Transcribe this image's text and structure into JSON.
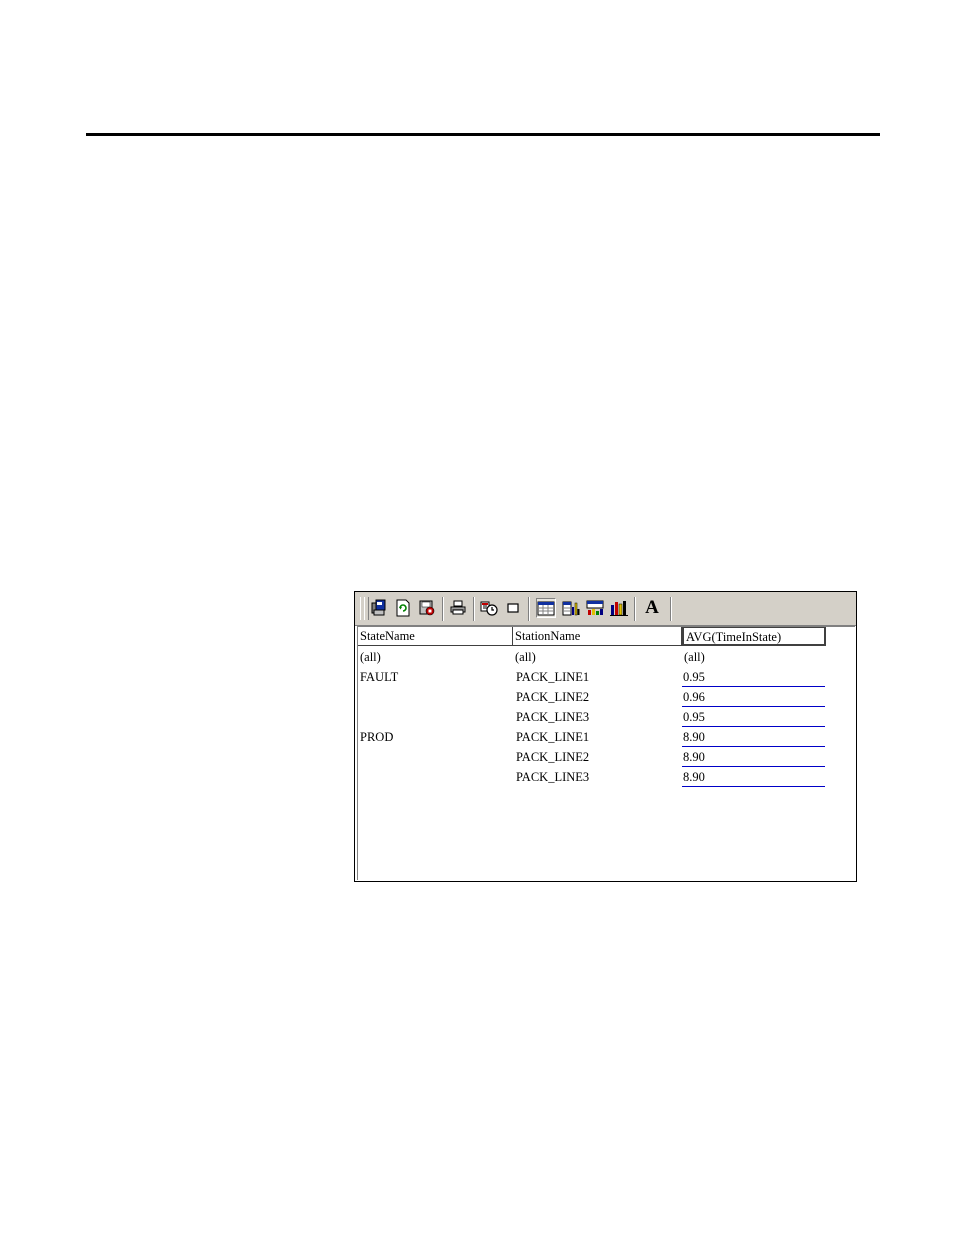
{
  "toolbar": {
    "buttons": [
      {
        "icon": "copy-to-clipboard-icon"
      },
      {
        "icon": "refresh-icon"
      },
      {
        "icon": "save-report-icon"
      },
      {
        "icon": "print-icon"
      },
      {
        "icon": "schedule-icon"
      },
      {
        "icon": "stop-icon"
      },
      {
        "icon": "grid-view-icon",
        "pressed": true
      },
      {
        "icon": "grid-chart-icon"
      },
      {
        "icon": "table-chart-icon"
      },
      {
        "icon": "bar-chart-icon"
      },
      {
        "icon": "font-icon",
        "glyph": "A"
      }
    ]
  },
  "table": {
    "columns": [
      "StateName",
      "StationName",
      "AVG(TimeInState)"
    ],
    "rows": [
      {
        "state": "(all)",
        "station": "(all)",
        "avg": "(all)"
      },
      {
        "state": "FAULT",
        "station": "PACK_LINE1",
        "avg": "0.95"
      },
      {
        "state": "",
        "station": "PACK_LINE2",
        "avg": "0.96"
      },
      {
        "state": "",
        "station": "PACK_LINE3",
        "avg": "0.95"
      },
      {
        "state": "PROD",
        "station": "PACK_LINE1",
        "avg": "8.90"
      },
      {
        "state": "",
        "station": "PACK_LINE2",
        "avg": "8.90"
      },
      {
        "state": "",
        "station": "PACK_LINE3",
        "avg": "8.90"
      }
    ]
  },
  "colors": {
    "toolbar_bg": "#d4d0c8",
    "value_underline": "#0000c8"
  }
}
